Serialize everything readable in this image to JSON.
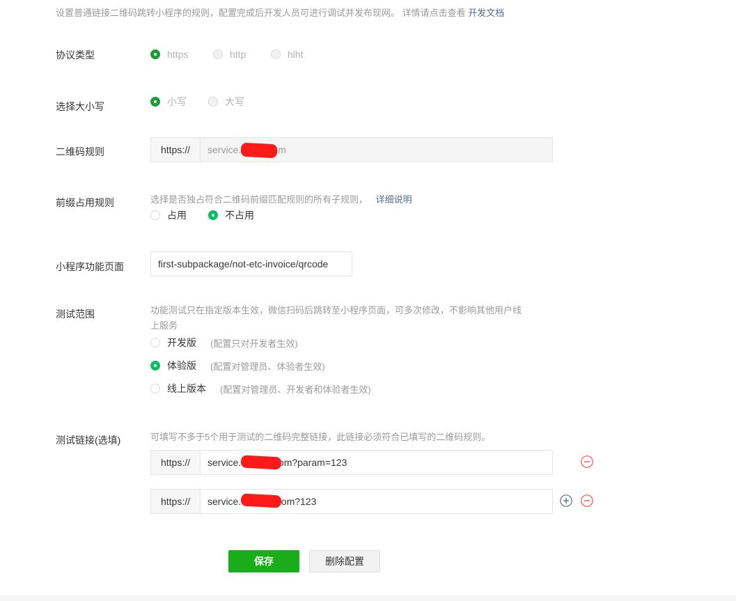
{
  "intro": {
    "text": "设置普通链接二维码跳转小程序的规则，配置完成后开发人员可进行调试并发布现网。 详情请点击查看",
    "link": "开发文档"
  },
  "protocol": {
    "label": "协议类型",
    "options": [
      "https",
      "http",
      "hlht"
    ],
    "selected": "https"
  },
  "case": {
    "label": "选择大小写",
    "options": [
      "小写",
      "大写"
    ],
    "selected": "小写"
  },
  "qr_rule": {
    "label": "二维码规则",
    "prefix": "https://",
    "value": "service.      ts.com"
  },
  "prefix_rule": {
    "label": "前缀占用规则",
    "desc": "选择是否独占符合二维码前缀匹配规则的所有子规则，",
    "link": "详细说明",
    "options": [
      "占用",
      "不占用"
    ],
    "selected": "不占用"
  },
  "page": {
    "label": "小程序功能页面",
    "value": "first-subpackage/not-etc-invoice/qrcode"
  },
  "scope": {
    "label": "测试范围",
    "desc_line1": "功能测试只在指定版本生效，微信扫码后跳转至小程序页面，可多次修改，不影响其他用户线",
    "desc_line2": "上服务",
    "options": [
      {
        "label": "开发版",
        "note": "(配置只对开发者生效)"
      },
      {
        "label": "体验版",
        "note": "(配置对管理员、体验者生效)"
      },
      {
        "label": "线上版本",
        "note": "(配置对管理员、开发者和体验者生效)"
      }
    ],
    "selected": "体验版"
  },
  "test_links": {
    "label": "测试链接(选填)",
    "desc": "可填写不多于5个用于测试的二维码完整链接，此链接必须符合已填写的二维码规则。",
    "prefix": "https://",
    "links": [
      "service.           .com?param=123",
      "service.            .com?123"
    ]
  },
  "icons": {
    "remove": "minus-circle-icon",
    "add": "plus-circle-icon"
  },
  "colors": {
    "primary": "#1aad19",
    "radio_checked": "#07c160",
    "link": "#576b95",
    "remove": "#fa5151",
    "redaction": "#ff1a1a"
  },
  "actions": {
    "save": "保存",
    "delete": "删除配置"
  }
}
